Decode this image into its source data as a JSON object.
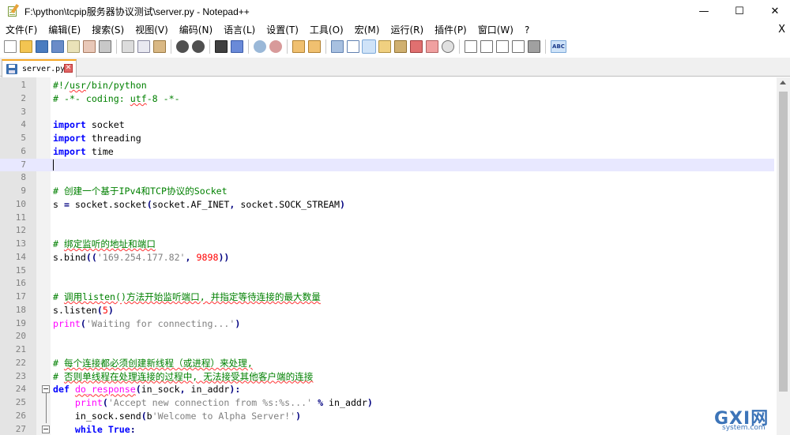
{
  "window": {
    "title": "F:\\python\\tcpip服务器协议测试\\server.py - Notepad++",
    "minimize": "—",
    "maximize": "☐",
    "close": "✕"
  },
  "menubar": {
    "items": [
      "文件(F)",
      "编辑(E)",
      "搜索(S)",
      "视图(V)",
      "编码(N)",
      "语言(L)",
      "设置(T)",
      "工具(O)",
      "宏(M)",
      "运行(R)",
      "插件(P)",
      "窗口(W)",
      "?"
    ],
    "close": "X"
  },
  "toolbar": {
    "abc_label": "ABC"
  },
  "tab": {
    "label": "server.py",
    "close": "✕"
  },
  "editor": {
    "current_line": 7,
    "lines": [
      {
        "n": "1",
        "text": "#!/usr/bin/python"
      },
      {
        "n": "2",
        "text": "# -*- coding: utf-8 -*-"
      },
      {
        "n": "3",
        "text": ""
      },
      {
        "n": "4",
        "text": "import socket"
      },
      {
        "n": "5",
        "text": "import threading"
      },
      {
        "n": "6",
        "text": "import time"
      },
      {
        "n": "7",
        "text": ""
      },
      {
        "n": "8",
        "text": ""
      },
      {
        "n": "9",
        "text": "# 创建一个基于IPv4和TCP协议的Socket"
      },
      {
        "n": "10",
        "text": "s = socket.socket(socket.AF_INET, socket.SOCK_STREAM)"
      },
      {
        "n": "11",
        "text": ""
      },
      {
        "n": "12",
        "text": ""
      },
      {
        "n": "13",
        "text": "# 绑定监听的地址和端口"
      },
      {
        "n": "14",
        "text": "s.bind(('169.254.177.82', 9898))"
      },
      {
        "n": "15",
        "text": ""
      },
      {
        "n": "16",
        "text": ""
      },
      {
        "n": "17",
        "text": "# 调用listen()方法开始监听端口, 并指定等待连接的最大数量"
      },
      {
        "n": "18",
        "text": "s.listen(5)"
      },
      {
        "n": "19",
        "text": "print('Waiting for connecting...')"
      },
      {
        "n": "20",
        "text": ""
      },
      {
        "n": "21",
        "text": ""
      },
      {
        "n": "22",
        "text": "# 每个连接都必须创建新线程（或进程）来处理,"
      },
      {
        "n": "23",
        "text": "# 否则单线程在处理连接的过程中, 无法接受其他客户端的连接"
      },
      {
        "n": "24",
        "text": "def do_response(in_sock, in_addr):"
      },
      {
        "n": "25",
        "text": "    print('Accept new connection from %s:%s...' % in_addr)"
      },
      {
        "n": "26",
        "text": "    in_sock.send(b'Welcome to Alpha Server!')"
      },
      {
        "n": "27",
        "text": "    while True:"
      }
    ]
  },
  "watermark": {
    "text": "GXI网",
    "sub": "system.com"
  }
}
